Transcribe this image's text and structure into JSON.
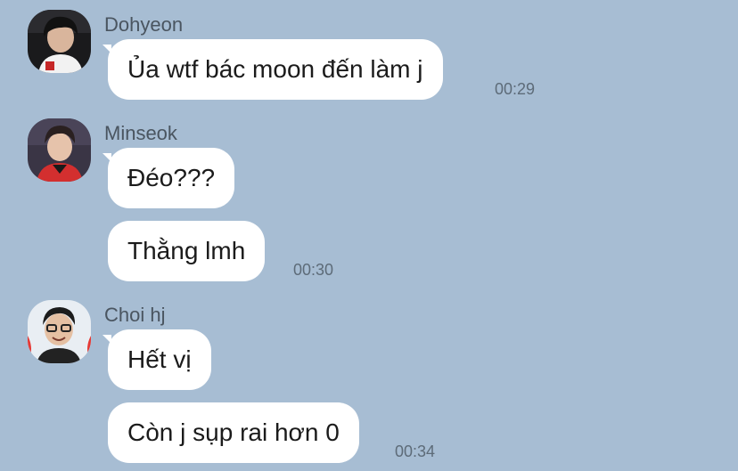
{
  "messages": [
    {
      "sender": "Dohyeon",
      "avatar_icon": "profile-photo-dohyeon",
      "bubbles": [
        {
          "text": "Ủa wtf bác moon đến làm j",
          "time": "00:29"
        }
      ]
    },
    {
      "sender": "Minseok",
      "avatar_icon": "profile-photo-minseok",
      "bubbles": [
        {
          "text": "Đéo???",
          "time": ""
        },
        {
          "text": "Thằng lmh",
          "time": "00:30"
        }
      ]
    },
    {
      "sender": "Choi hj",
      "avatar_icon": "profile-photo-choi-hj",
      "bubbles": [
        {
          "text": "Hết vị",
          "time": ""
        },
        {
          "text": "Còn j sụp rai hơn 0",
          "time": "00:34"
        }
      ]
    }
  ],
  "colors": {
    "background": "#a7bdd3",
    "bubble": "#ffffff",
    "sender_text": "#4a5560",
    "time_text": "#5d6b78"
  }
}
